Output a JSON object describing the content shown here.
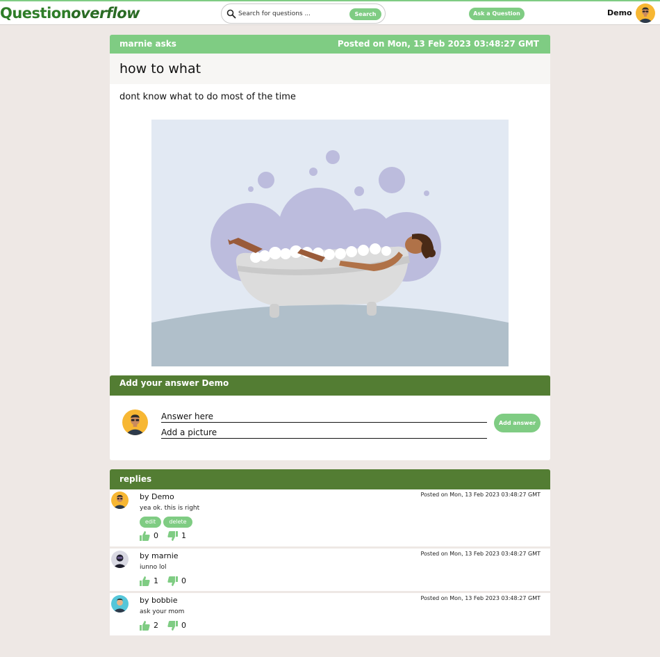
{
  "nav": {
    "logo_main": "Question",
    "logo_italic": "overflow",
    "search_placeholder": "Search for questions ...",
    "search_button": "Search",
    "ask_button": "Ask a Question",
    "user_name": "Demo"
  },
  "question": {
    "asker": "marnie asks",
    "posted": "Posted on Mon, 13 Feb 2023 03:48:27 GMT",
    "title": "how to what",
    "body": "dont know what to do most of the time",
    "image_icon": "woman-in-bathtub-illustration"
  },
  "answer_form": {
    "header": "Add your answer Demo",
    "answer_placeholder": "Answer here",
    "picture_placeholder": "Add a picture",
    "submit": "Add answer"
  },
  "replies": {
    "header": "replies",
    "items": [
      {
        "author": "by Demo",
        "posted": "Posted on Mon, 13 Feb 2023 03:48:27 GMT",
        "text": "yea ok. this is right",
        "edit": "edit",
        "delete": "delete",
        "up": "0",
        "down": "1"
      },
      {
        "author": "by marnie",
        "posted": "Posted on Mon, 13 Feb 2023 03:48:27 GMT",
        "text": "iunno lol",
        "up": "1",
        "down": "0"
      },
      {
        "author": "by bobbie",
        "posted": "Posted on Mon, 13 Feb 2023 03:48:27 GMT",
        "text": "ask your mom",
        "up": "2",
        "down": "0"
      }
    ]
  },
  "colors": {
    "accent_light": "#7fcc83",
    "accent_dark": "#537d33",
    "logo_green": "#2e7d28",
    "background": "#eee8e5"
  }
}
